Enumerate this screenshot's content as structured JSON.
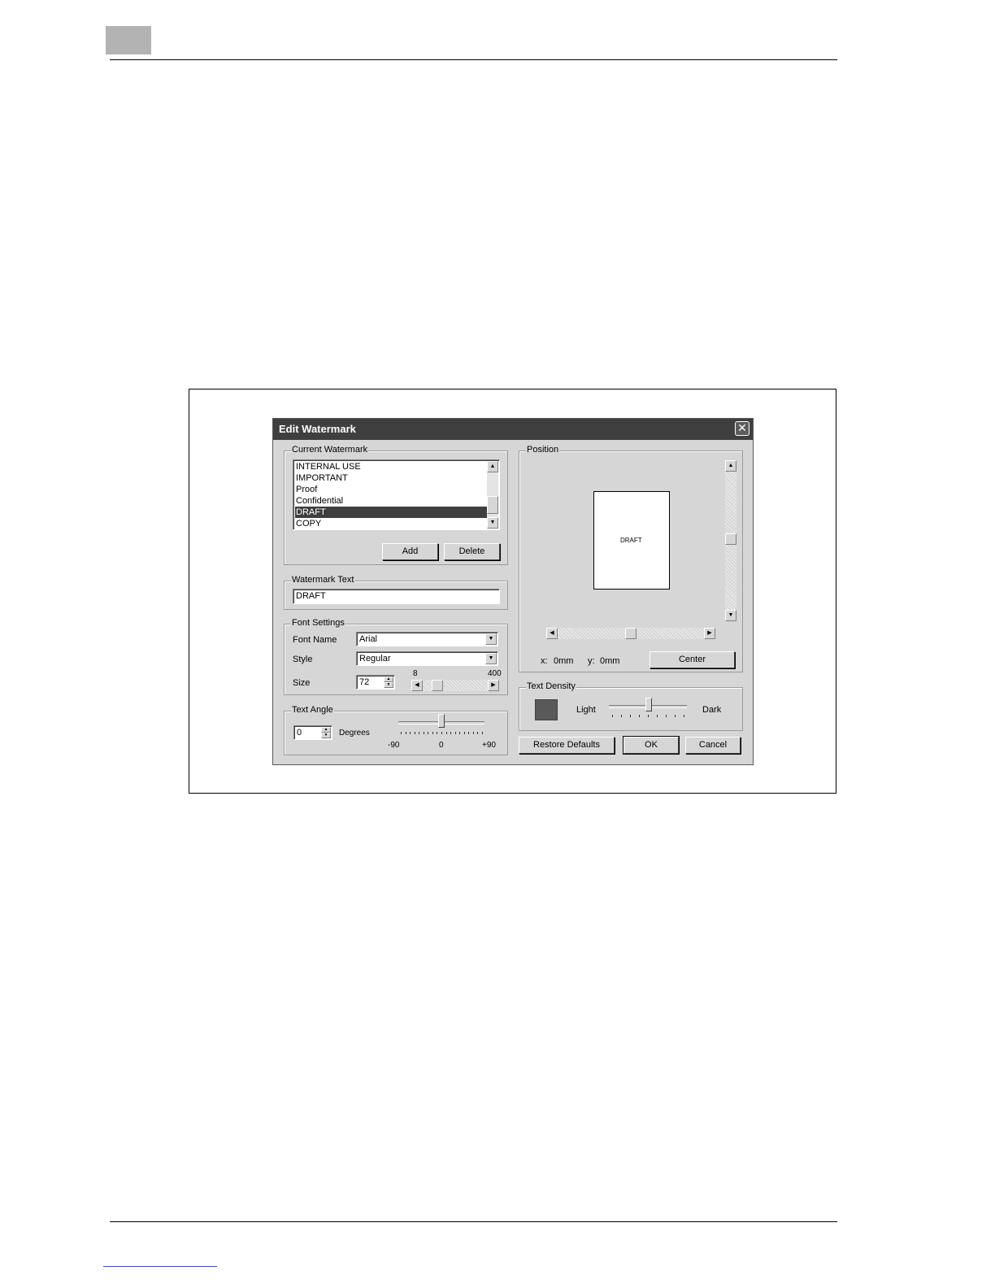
{
  "dialog": {
    "title": "Edit Watermark",
    "current_watermark": {
      "legend": "Current Watermark",
      "items": [
        "INTERNAL USE",
        "IMPORTANT",
        "Proof",
        "Confidential",
        "DRAFT",
        "COPY"
      ],
      "selected": "DRAFT",
      "add_label": "Add",
      "delete_label": "Delete"
    },
    "watermark_text": {
      "legend": "Watermark Text",
      "value": "DRAFT"
    },
    "font_settings": {
      "legend": "Font Settings",
      "font_name_label": "Font Name",
      "font_name_value": "Arial",
      "style_label": "Style",
      "style_value": "Regular",
      "size_label": "Size",
      "size_value": "72",
      "size_min": "8",
      "size_max": "400"
    },
    "text_angle": {
      "legend": "Text Angle",
      "value": "0",
      "unit_label": "Degrees",
      "min_label": "-90",
      "mid_label": "0",
      "max_label": "+90"
    },
    "position": {
      "legend": "Position",
      "preview_text": "DRAFT",
      "x_label": "x:",
      "x_value": "0mm",
      "y_label": "y:",
      "y_value": "0mm",
      "center_label": "Center"
    },
    "text_density": {
      "legend": "Text Density",
      "light_label": "Light",
      "dark_label": "Dark",
      "swatch_color": "#595959"
    },
    "buttons": {
      "restore_label": "Restore Defaults",
      "ok_label": "OK",
      "cancel_label": "Cancel"
    }
  }
}
